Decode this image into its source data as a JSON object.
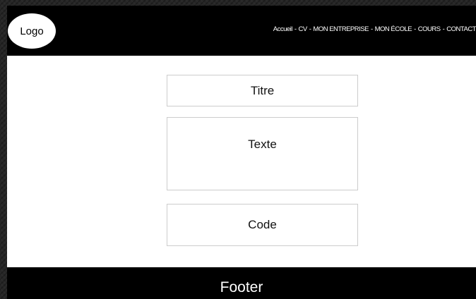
{
  "header": {
    "logo_label": "Logo",
    "nav": {
      "separator": "-",
      "items": [
        {
          "label": "Accueil"
        },
        {
          "label": "CV"
        },
        {
          "label": "MON ENTREPRISE"
        },
        {
          "label": "MON ÉCOLE"
        },
        {
          "label": "COURS"
        },
        {
          "label": "CONTACT"
        }
      ]
    }
  },
  "main": {
    "title_label": "Titre",
    "text_label": "Texte",
    "code_label": "Code"
  },
  "footer": {
    "label": "Footer"
  },
  "colors": {
    "header_background": "#000000",
    "page_background": "#ffffff",
    "box_border": "#cccccc",
    "outer_background": "#262626"
  }
}
